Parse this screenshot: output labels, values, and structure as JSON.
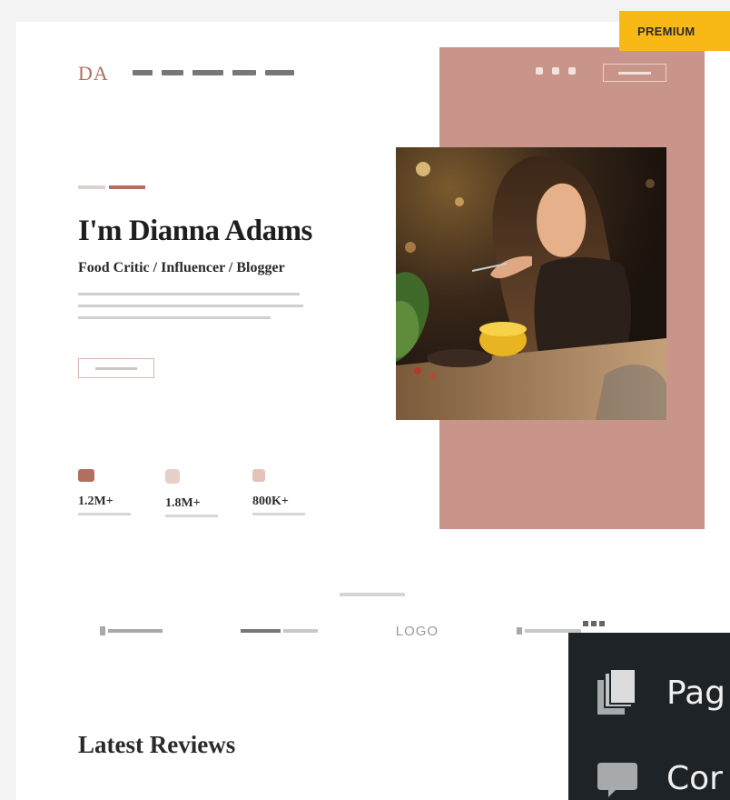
{
  "badge": {
    "label": "PREMIUM"
  },
  "site": {
    "logo": "DA"
  },
  "hero": {
    "title": "I'm Dianna Adams",
    "subtitle": "Food Critic / Influencer / Blogger"
  },
  "stats": [
    {
      "icon": "youtube-icon",
      "value": "1.2M+"
    },
    {
      "icon": "instagram-icon",
      "value": "1.8M+"
    },
    {
      "icon": "rss-icon",
      "value": "800K+"
    }
  ],
  "brands": {
    "logo_3": "LOGO"
  },
  "section": {
    "title": "Latest Reviews"
  },
  "admin_menu": [
    {
      "icon": "pages-icon",
      "label": "Pag"
    },
    {
      "icon": "comments-icon",
      "label": "Cor"
    }
  ],
  "colors": {
    "accent": "#b0705f",
    "panel": "#c9948a",
    "badge": "#f8b917",
    "admin_bg": "#1d2327"
  }
}
